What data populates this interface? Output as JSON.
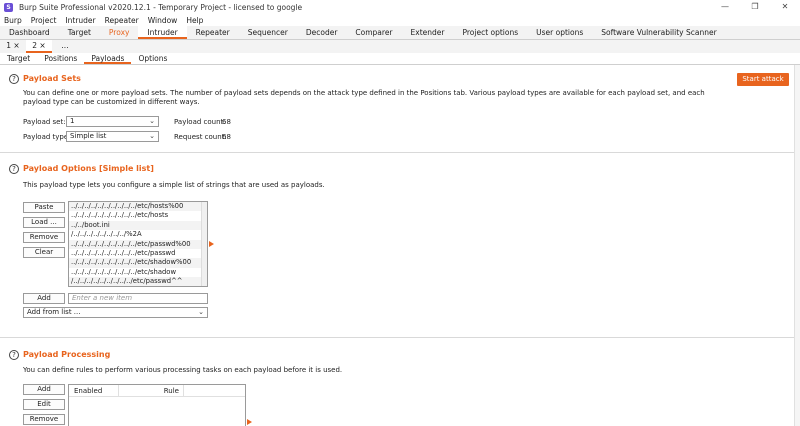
{
  "window": {
    "title": "Burp Suite Professional v2020.12.1 - Temporary Project - licensed to google",
    "app_icon": "burp-logo-icon",
    "controls": [
      "—",
      "❐",
      "✕"
    ]
  },
  "menu": [
    "Burp",
    "Project",
    "Intruder",
    "Repeater",
    "Window",
    "Help"
  ],
  "main_tabs": [
    "Dashboard",
    "Target",
    "Proxy",
    "Intruder",
    "Repeater",
    "Sequencer",
    "Decoder",
    "Comparer",
    "Extender",
    "Project options",
    "User options",
    "Software Vulnerability Scanner"
  ],
  "intruder_tabs": [
    "1 ×",
    "2 ×",
    "..."
  ],
  "sub_tabs": [
    "Target",
    "Positions",
    "Payloads",
    "Options"
  ],
  "payload_sets": {
    "title": "Payload Sets",
    "description": "You can define one or more payload sets. The number of payload sets depends on the attack type defined in the Positions tab. Various payload types are available for each payload set, and each payload type can be customized in different ways.",
    "set_label": "Payload set:",
    "set_value": "1",
    "type_label": "Payload type:",
    "type_value": "Simple list",
    "payload_count_label": "Payload count:",
    "payload_count": "68",
    "request_count_label": "Request count:",
    "request_count": "68",
    "start_attack": "Start attack"
  },
  "payload_options": {
    "title": "Payload Options [Simple list]",
    "description": "This payload type lets you configure a simple list of strings that are used as payloads.",
    "buttons": [
      "Paste",
      "Load ...",
      "Remove",
      "Clear"
    ],
    "items": [
      "../../../../../../../../../../etc/hosts%00",
      "../../../../../../../../../../etc/hosts",
      "../../boot.ini",
      "/../../../../../../../../%2A",
      "../../../../../../../../../../etc/passwd%00",
      "../../../../../../../../../../etc/passwd",
      "../../../../../../../../../../etc/shadow%00",
      "../../../../../../../../../../etc/shadow",
      "/../../../../../../../../../etc/passwd^^"
    ],
    "add_button": "Add",
    "add_placeholder": "Enter a new item",
    "add_from_list": "Add from list ..."
  },
  "payload_processing": {
    "title": "Payload Processing",
    "description": "You can define rules to perform various processing tasks on each payload before it is used.",
    "buttons": [
      "Add",
      "Edit",
      "Remove"
    ],
    "columns": [
      "Enabled",
      "Rule"
    ]
  },
  "colors": {
    "accent": "#e8641e"
  }
}
